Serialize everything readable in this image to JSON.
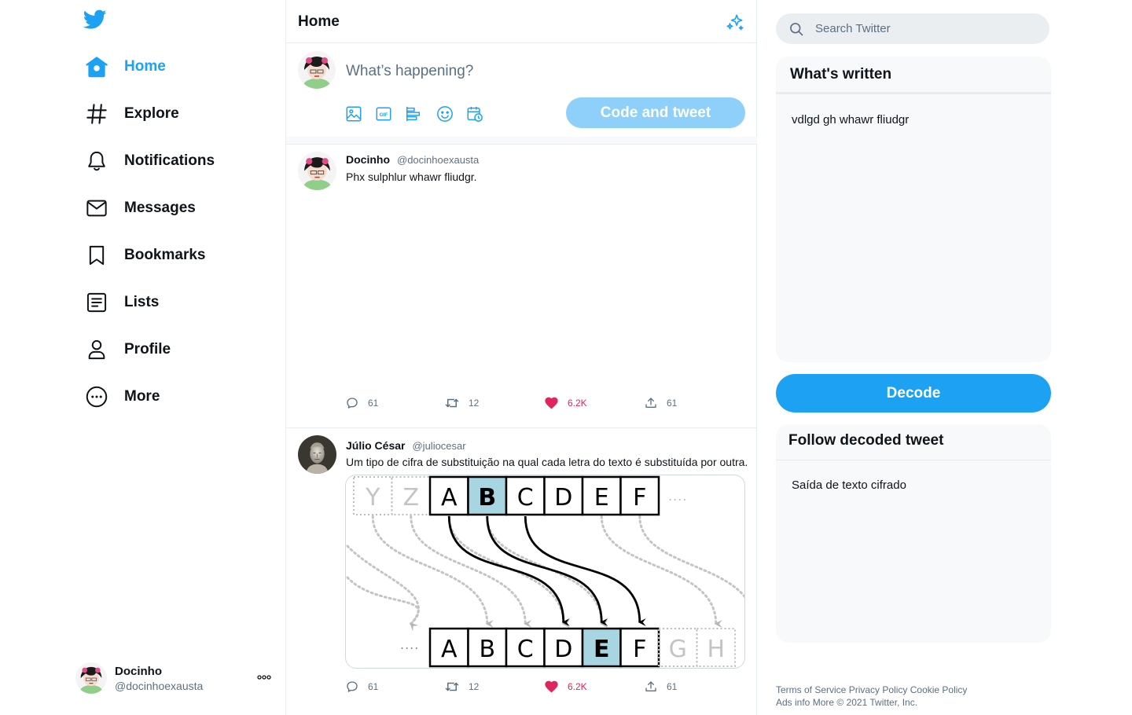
{
  "nav": {
    "items": [
      {
        "label": "Home",
        "icon": "home-icon",
        "active": true
      },
      {
        "label": "Explore",
        "icon": "hashtag-icon"
      },
      {
        "label": "Notifications",
        "icon": "bell-icon"
      },
      {
        "label": "Messages",
        "icon": "envelope-icon"
      },
      {
        "label": "Bookmarks",
        "icon": "bookmark-icon"
      },
      {
        "label": "Lists",
        "icon": "list-icon"
      },
      {
        "label": "Profile",
        "icon": "user-icon"
      },
      {
        "label": "More",
        "icon": "more-circle-icon"
      }
    ]
  },
  "account": {
    "name": "Docinho",
    "handle": "@docinhoexausta"
  },
  "main": {
    "title": "Home",
    "composer": {
      "placeholder": "What’s happening?",
      "button": "Code and tweet"
    }
  },
  "tweets": [
    {
      "name": "Docinho",
      "handle": "@docinhoexausta",
      "text": "Phx sulphlur whawr fliudgr.",
      "replies": "61",
      "retweets": "12",
      "likes": "6.2K",
      "shares": "61"
    },
    {
      "name": "Júlio César",
      "handle": "@juliocesar",
      "text": "Um tipo de cifra de substituição na qual cada letra do texto é substituída por outra.",
      "replies": "61",
      "retweets": "12",
      "likes": "6.2K",
      "shares": "61",
      "diagram": {
        "top_faded": [
          "Y",
          "Z"
        ],
        "top": [
          "A",
          "B",
          "C",
          "D",
          "E",
          "F"
        ],
        "bottom": [
          "A",
          "B",
          "C",
          "D",
          "E",
          "F"
        ],
        "bottom_faded": [
          "G",
          "H"
        ],
        "dots": "....",
        "highlight_top": "B",
        "highlight_bottom": "E"
      }
    }
  ],
  "search": {
    "placeholder": "Search Twitter"
  },
  "written": {
    "title": "What's written",
    "body": "vdlgd gh whawr fliudgr"
  },
  "decode": {
    "label": "Decode"
  },
  "decoded": {
    "title": "Follow decoded tweet",
    "body": "Saída de texto cifrado"
  },
  "footer": {
    "line1": [
      "Terms of Service",
      "Privacy Policy",
      "Cookie Policy"
    ],
    "line2_links": [
      "Ads info",
      "More"
    ],
    "copyright": "© 2021 Twitter, Inc."
  },
  "colors": {
    "accent": "#1da1f2",
    "like": "#e0245e",
    "highlight": "#a8d5e2"
  }
}
